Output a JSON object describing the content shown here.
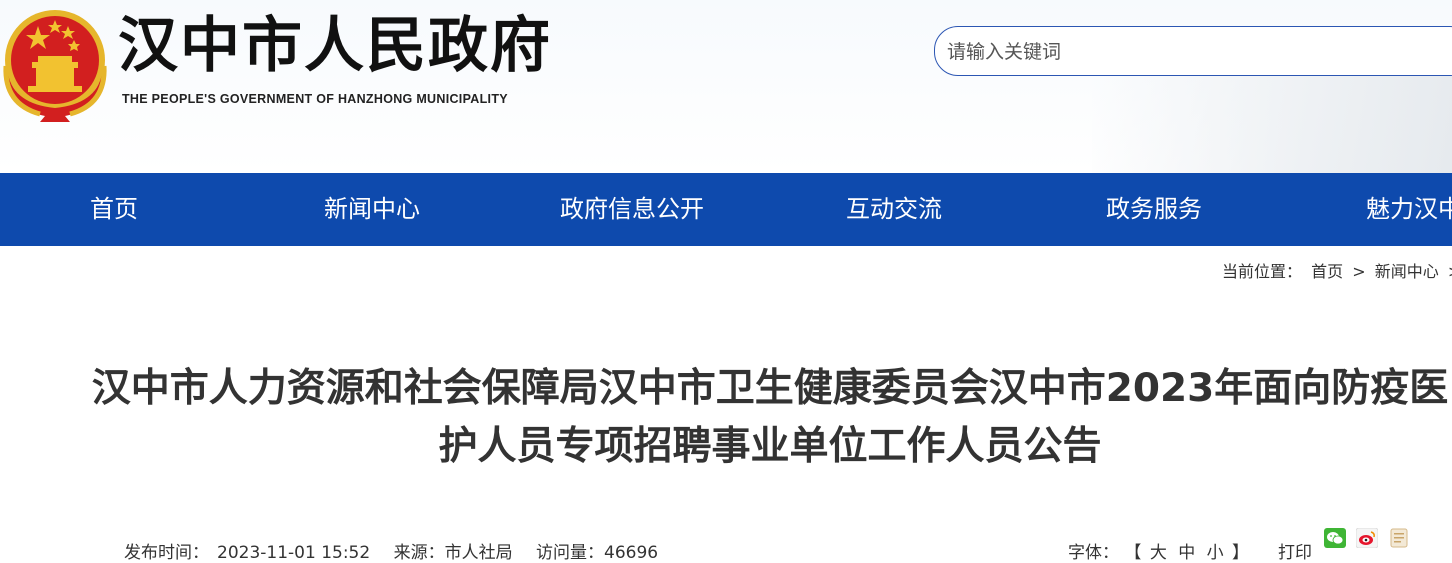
{
  "header": {
    "title": "汉中市人民政府",
    "subtitle": "THE PEOPLE'S GOVERNMENT OF HANZHONG MUNICIPALITY",
    "search_placeholder": "请输入关键词"
  },
  "nav": {
    "items": [
      "首页",
      "新闻中心",
      "政府信息公开",
      "互动交流",
      "政务服务",
      "魅力汉中"
    ]
  },
  "breadcrumb": {
    "label": "当前位置：",
    "path": [
      "首页",
      ">",
      "新闻中心",
      ">"
    ]
  },
  "article": {
    "title_line1": "汉中市人力资源和社会保障局汉中市卫生健康委员会汉中市2023年面向防疫医",
    "title_line2": "护人员专项招聘事业单位工作人员公告",
    "publish_label": "发布时间：",
    "publish_time": "2023-11-01 15:52",
    "source_label": "来源：",
    "source": "市人社局",
    "views_label": "访问量：",
    "views": "46696",
    "font_label": "字体：",
    "font_open": "【",
    "font_large": "大",
    "font_medium": "中",
    "font_small": "小",
    "font_close": "】",
    "print_label": "打印"
  },
  "icons": {
    "share": [
      "wechat-icon",
      "weibo-icon",
      "copy-icon"
    ]
  },
  "colors": {
    "nav_bg": "#0e4aad",
    "search_border": "#2c56b3",
    "emblem_red": "#d21f1f",
    "emblem_gold": "#f2c230"
  }
}
